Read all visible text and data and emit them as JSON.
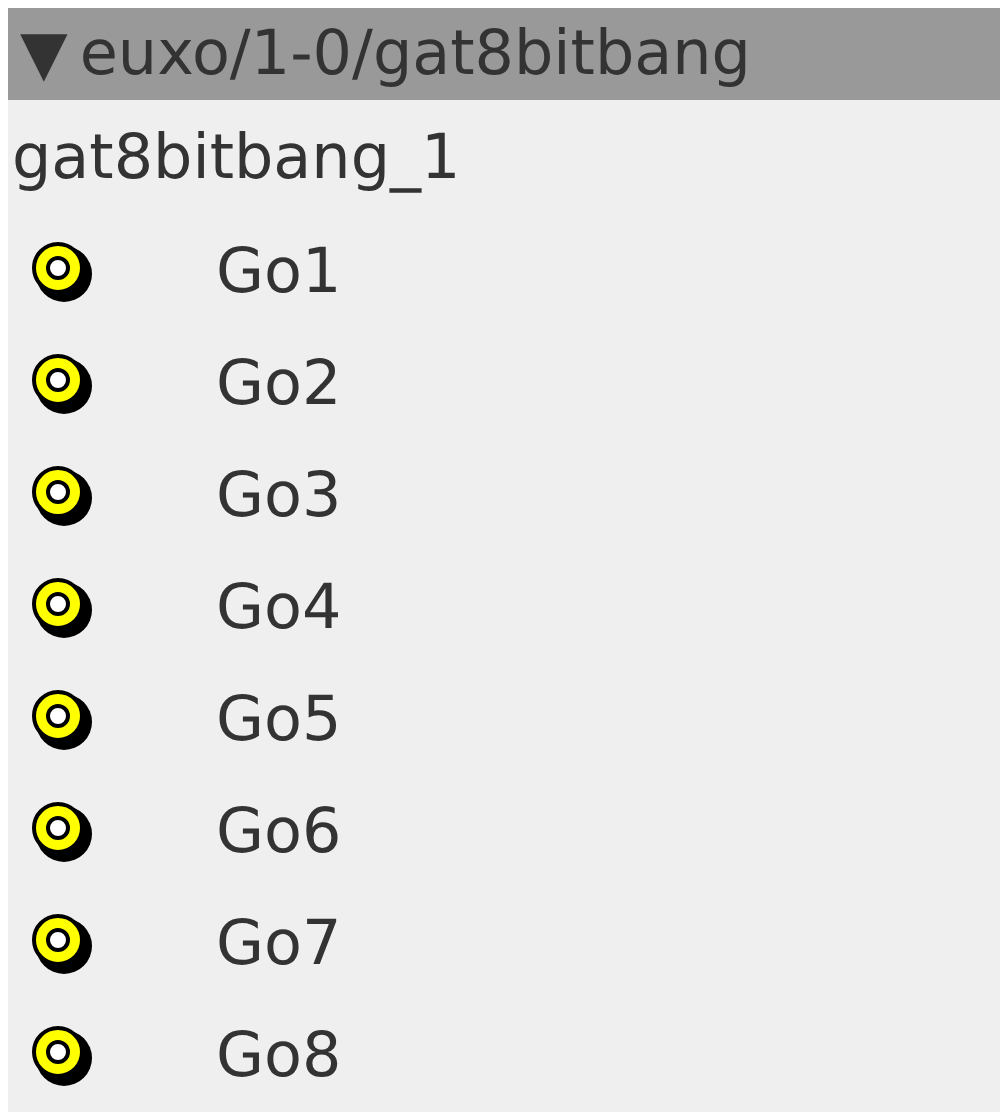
{
  "header": {
    "toggle": "▼",
    "title": "euxo/1-0/gat8bitbang"
  },
  "instance": "gat8bitbang_1",
  "outputs": [
    {
      "label": "Go1"
    },
    {
      "label": "Go2"
    },
    {
      "label": "Go3"
    },
    {
      "label": "Go4"
    },
    {
      "label": "Go5"
    },
    {
      "label": "Go6"
    },
    {
      "label": "Go7"
    },
    {
      "label": "Go8"
    }
  ]
}
